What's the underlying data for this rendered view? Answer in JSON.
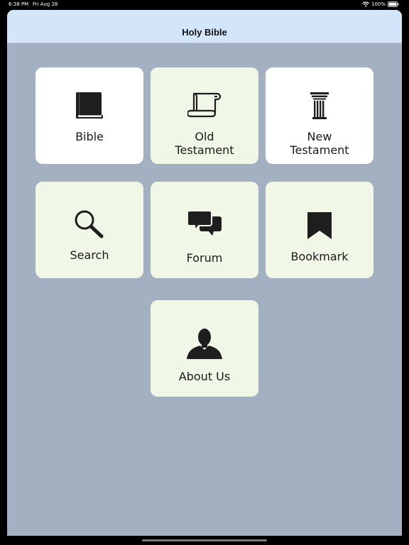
{
  "status_bar": {
    "time": "6:38 PM",
    "date": "Fri Aug 28",
    "battery": "100%",
    "wifi_icon": "wifi-icon",
    "battery_icon": "battery-icon"
  },
  "header": {
    "title": "Holy Bible"
  },
  "menu": {
    "bible": {
      "label": "Bible",
      "icon": "book-icon"
    },
    "old_testament": {
      "label": "Old\nTestament",
      "icon": "scroll-icon"
    },
    "new_testament": {
      "label": "New\nTestament",
      "icon": "pillar-icon"
    },
    "search": {
      "label": "Search",
      "icon": "magnifier-icon"
    },
    "forum": {
      "label": "Forum",
      "icon": "chat-bubbles-icon"
    },
    "bookmark": {
      "label": "Bookmark",
      "icon": "bookmark-icon"
    },
    "about_us": {
      "label": "About Us",
      "icon": "person-icon"
    }
  },
  "colors": {
    "background": "#a3b0c2",
    "header": "#d2e5f9",
    "tile_white": "#ffffff",
    "tile_green": "#f1f7e6"
  }
}
